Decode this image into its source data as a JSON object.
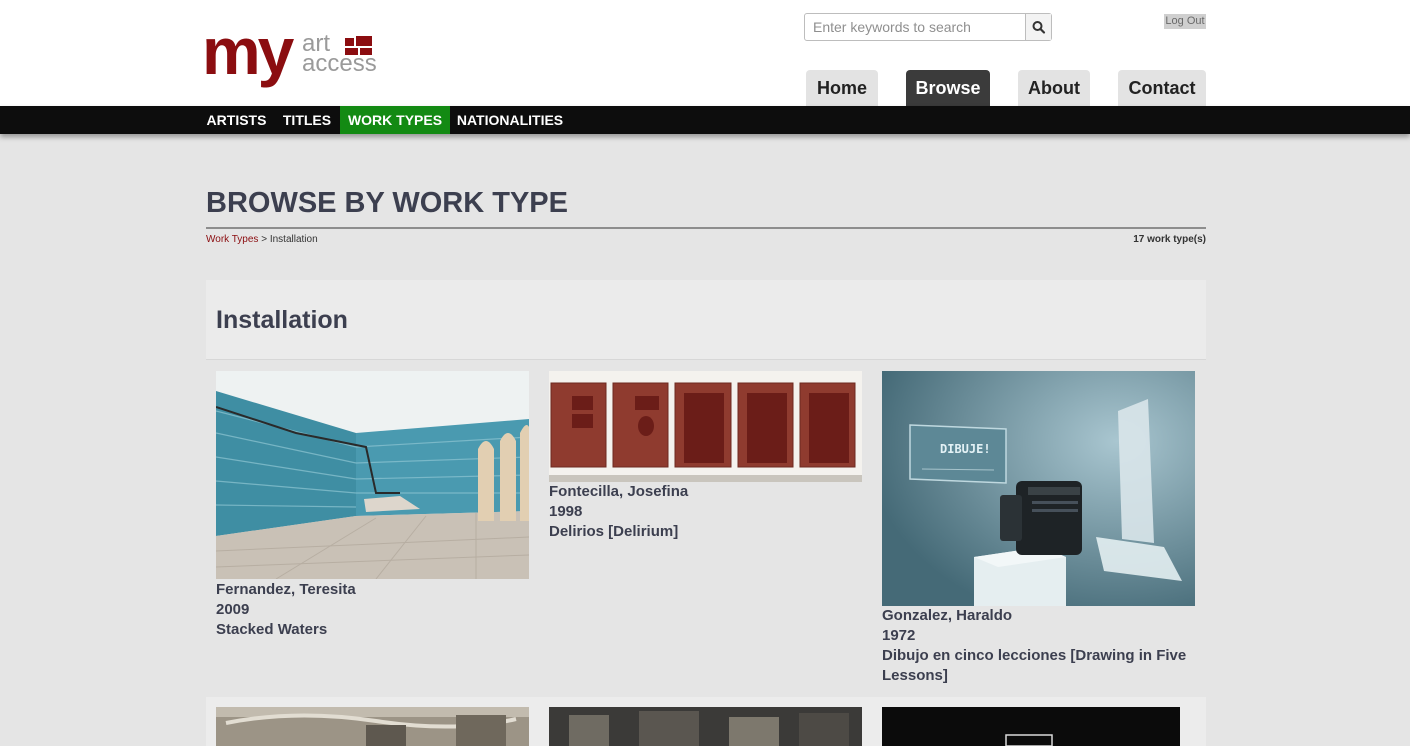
{
  "logo": {
    "my": "my",
    "art": "art",
    "access": "access"
  },
  "search": {
    "placeholder": "Enter keywords to search",
    "button_icon": "search-icon"
  },
  "header": {
    "logout_label": "Log Out"
  },
  "nav": {
    "home": "Home",
    "browse": "Browse",
    "about": "About",
    "contact": "Contact",
    "active": "Browse"
  },
  "categories": {
    "artists": "ARTISTS",
    "titles": "TITLES",
    "work_types": "WORK TYPES",
    "nationalities": "NATIONALITIES",
    "active": "WORK TYPES"
  },
  "page": {
    "title": "BROWSE BY WORK TYPE",
    "breadcrumb_link": "Work Types",
    "breadcrumb_sep": ">",
    "breadcrumb_current": "Installation",
    "count": "17 work type(s)"
  },
  "section": {
    "title": "Installation"
  },
  "works": [
    {
      "artist": "Fernandez, Teresita",
      "year": "2009",
      "title": "Stacked Waters"
    },
    {
      "artist": "Fontecilla, Josefina",
      "year": "1998",
      "title": "Delirios [Delirium]"
    },
    {
      "artist": "Gonzalez, Haraldo",
      "year": "1972",
      "title": "Dibujo en cinco lecciones [Drawing in Five Lessons]",
      "image_text": "DIBUJE!"
    }
  ],
  "colors": {
    "brand": "#8b0d10",
    "active_category": "#138a13",
    "nav_active": "#3b3b3b",
    "heading": "#3c3f4f"
  }
}
